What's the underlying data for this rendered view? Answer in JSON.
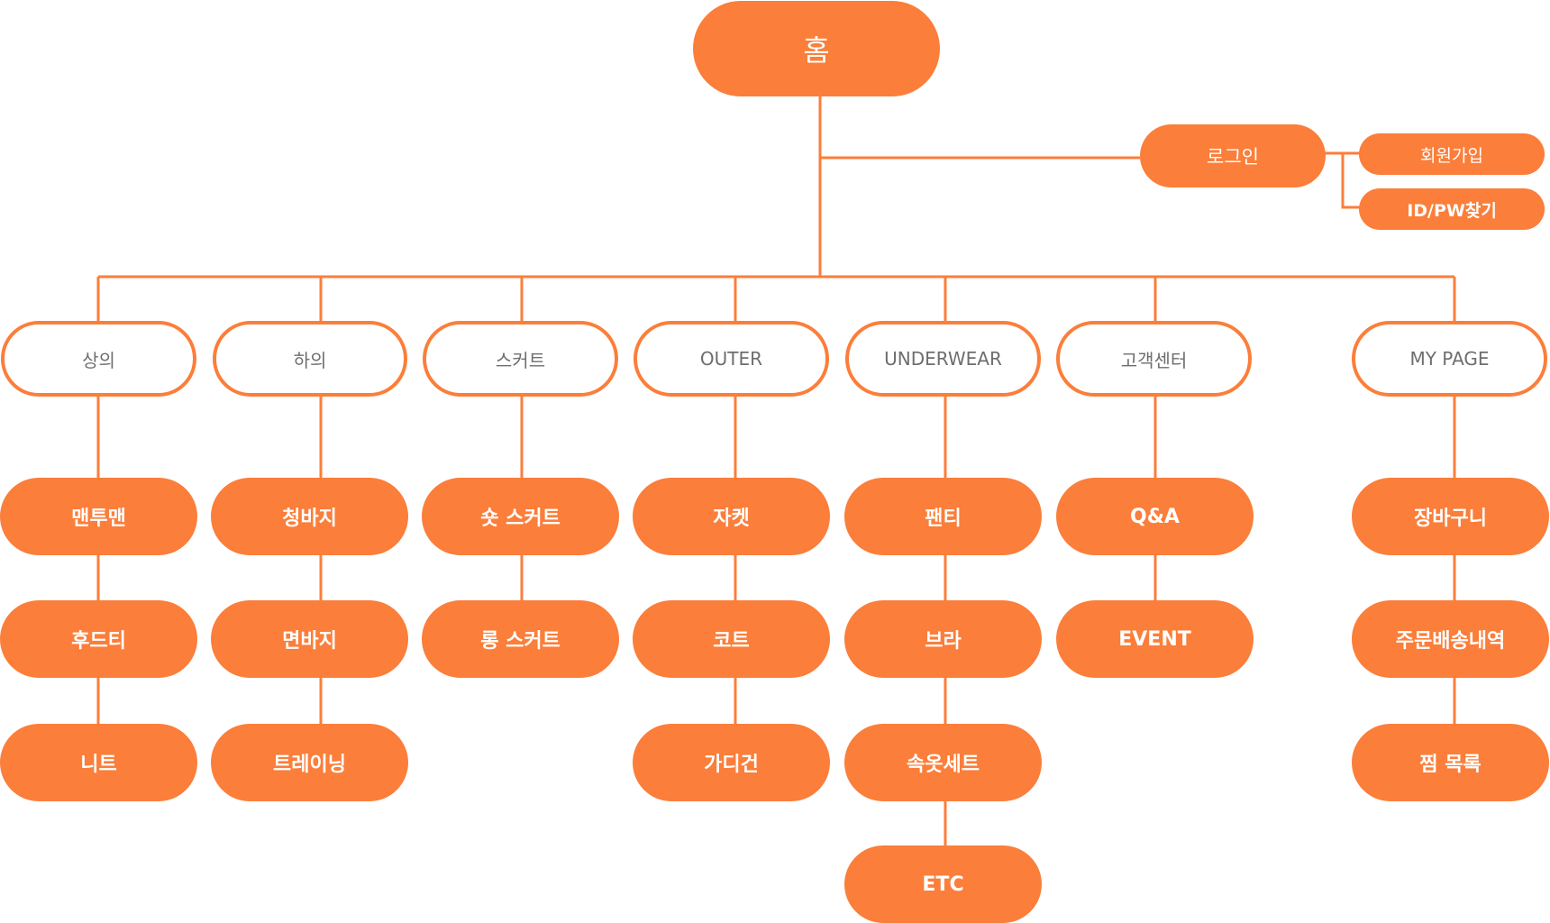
{
  "colors": {
    "accent": "#FB7E3A",
    "outline_text": "#6e6e6e",
    "background": "#ffffff"
  },
  "root": {
    "label": "홈"
  },
  "login": {
    "label": "로그인",
    "children": [
      "회원가입",
      "ID/PW찾기"
    ]
  },
  "categories": [
    {
      "label": "상의",
      "children": [
        "맨투맨",
        "후드티",
        "니트"
      ]
    },
    {
      "label": "하의",
      "children": [
        "청바지",
        "면바지",
        "트레이닝"
      ]
    },
    {
      "label": "스커트",
      "children": [
        "숏 스커트",
        "롱 스커트"
      ]
    },
    {
      "label": "OUTER",
      "children": [
        "자켓",
        "코트",
        "가디건"
      ]
    },
    {
      "label": "UNDERWEAR",
      "children": [
        "팬티",
        "브라",
        "속옷세트",
        "ETC"
      ]
    },
    {
      "label": "고객센터",
      "children": [
        "Q&A",
        "EVENT"
      ]
    },
    {
      "label": "MY PAGE",
      "children": [
        "장바구니",
        "주문배송내역",
        "찜 목록"
      ]
    }
  ]
}
